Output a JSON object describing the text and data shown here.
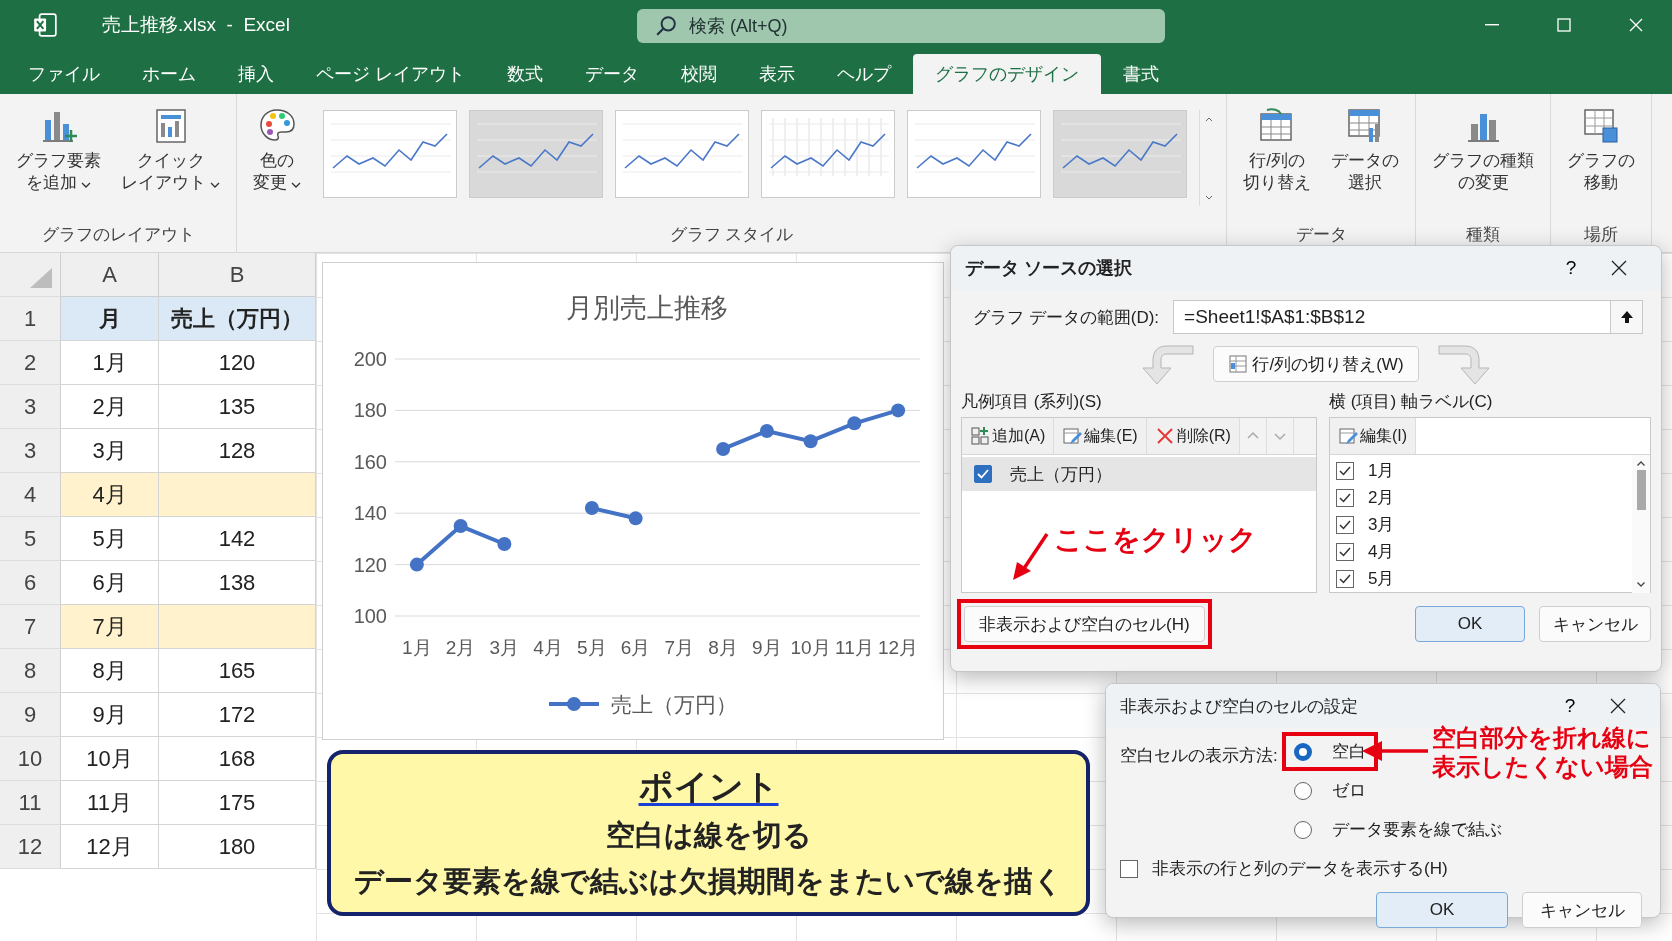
{
  "window": {
    "title": "売上推移.xlsx  -  Excel",
    "search_placeholder": "検索 (Alt+Q)"
  },
  "tabs": [
    {
      "label": "ファイル",
      "selected": false
    },
    {
      "label": "ホーム",
      "selected": false
    },
    {
      "label": "挿入",
      "selected": false
    },
    {
      "label": "ページ レイアウト",
      "selected": false
    },
    {
      "label": "数式",
      "selected": false
    },
    {
      "label": "データ",
      "selected": false
    },
    {
      "label": "校閲",
      "selected": false
    },
    {
      "label": "表示",
      "selected": false
    },
    {
      "label": "ヘルプ",
      "selected": false
    },
    {
      "label": "グラフのデザイン",
      "selected": true
    },
    {
      "label": "書式",
      "selected": false
    }
  ],
  "ribbon": [
    {
      "label": "グラフのレイアウト",
      "buttons": [
        {
          "lines": [
            "グラフ要素",
            "を追加"
          ],
          "dropdown": true
        },
        {
          "lines": [
            "クイック",
            "レイアウト"
          ],
          "dropdown": true
        }
      ]
    },
    {
      "label": "グラフ スタイル",
      "buttons": [
        {
          "lines": [
            "色の",
            "変更"
          ],
          "dropdown": true
        }
      ],
      "gallery": [
        {
          "kind": "plain"
        },
        {
          "kind": "shaded"
        },
        {
          "kind": "plain"
        },
        {
          "kind": "grid"
        },
        {
          "kind": "plain"
        },
        {
          "kind": "shaded"
        }
      ]
    },
    {
      "label": "データ",
      "buttons": [
        {
          "lines": [
            "行/列の",
            "切り替え"
          ],
          "dropdown": false
        },
        {
          "lines": [
            "データの",
            "選択"
          ],
          "dropdown": false
        }
      ]
    },
    {
      "label": "種類",
      "buttons": [
        {
          "lines": [
            "グラフの種類",
            "の変更"
          ],
          "dropdown": false
        }
      ]
    },
    {
      "label": "場所",
      "buttons": [
        {
          "lines": [
            "グラフの",
            "移動"
          ],
          "dropdown": false
        }
      ]
    }
  ],
  "sheet": {
    "columns": [
      "A",
      "B"
    ],
    "rows": [
      {
        "number": "1",
        "kind": "header",
        "cells": [
          "月",
          "売上（万円）"
        ]
      },
      {
        "number": "2",
        "kind": "normal",
        "cells": [
          "1月",
          "120"
        ]
      },
      {
        "number": "3",
        "kind": "normal",
        "cells": [
          "2月",
          "135"
        ]
      },
      {
        "number": "3",
        "kind": "normal",
        "cells": [
          "3月",
          "128"
        ]
      },
      {
        "number": "4",
        "kind": "missing",
        "cells": [
          "4月"
        ]
      },
      {
        "number": "5",
        "kind": "normal",
        "cells": [
          "5月",
          "142"
        ]
      },
      {
        "number": "6",
        "kind": "normal",
        "cells": [
          "6月",
          "138"
        ]
      },
      {
        "number": "7",
        "kind": "missing",
        "cells": [
          "7月"
        ]
      },
      {
        "number": "8",
        "kind": "normal",
        "cells": [
          "8月",
          "165"
        ]
      },
      {
        "number": "9",
        "kind": "normal",
        "cells": [
          "9月",
          "172"
        ]
      },
      {
        "number": "10",
        "kind": "normal",
        "cells": [
          "10月",
          "168"
        ]
      },
      {
        "number": "11",
        "kind": "normal",
        "cells": [
          "11月",
          "175"
        ]
      },
      {
        "number": "12",
        "kind": "normal",
        "cells": [
          "12月",
          "180"
        ]
      }
    ]
  },
  "chart": {
    "chart_data": {
      "type": "line",
      "title": "月別売上推移",
      "categories": [
        "1月",
        "2月",
        "3月",
        "4月",
        "5月",
        "6月",
        "7月",
        "8月",
        "9月",
        "10月",
        "11月",
        "12月"
      ],
      "series": [
        {
          "name": "売上（万円）",
          "color": "#4472c4",
          "marker": true,
          "values": [
            120,
            135,
            128,
            null,
            142,
            138,
            null,
            165,
            172,
            168,
            175,
            180
          ]
        }
      ],
      "grid": true,
      "ylim": [
        100,
        200
      ],
      "yticks": [
        100,
        120,
        140,
        160,
        180,
        200
      ]
    }
  },
  "callout": {
    "title": "ポイント",
    "lines": [
      "空白は線を切る",
      "データ要素を線で結ぶは欠損期間をまたいで線を描く"
    ]
  },
  "source_dialog": {
    "title": "データ ソースの選択",
    "help": "?",
    "range_label": "グラフ データの範囲(D):",
    "range_value": "=Sheet1!$A$1:$B$12",
    "switch_button": "行/列の切り替え(W)",
    "series_label": "凡例項目 (系列)(S)",
    "series_buttons": [
      "追加(A)",
      "編集(E)",
      "削除(R)"
    ],
    "series": [
      {
        "label": "売上（万円）",
        "checked": true,
        "selected": true
      }
    ],
    "axis_label": "横 (項目) 軸ラベル(C)",
    "axis_button": "編集(I)",
    "axis_items": [
      {
        "label": "1月",
        "checked": true
      },
      {
        "label": "2月",
        "checked": true
      },
      {
        "label": "3月",
        "checked": true
      },
      {
        "label": "4月",
        "checked": true
      },
      {
        "label": "5月",
        "checked": true
      }
    ],
    "hidden_button": "非表示および空白のセル(H)",
    "ok": "OK",
    "cancel": "キャンセル",
    "annotation": "ここをクリック"
  },
  "cells_dialog": {
    "title": "非表示および空白のセルの設定",
    "help": "?",
    "empty_label": "空白セルの表示方法:",
    "options": [
      {
        "label": "空白",
        "selected": true
      },
      {
        "label": "ゼロ",
        "selected": false
      },
      {
        "label": "データ要素を線で結ぶ",
        "selected": false
      }
    ],
    "hidden_checkbox": {
      "label": "非表示の行と列のデータを表示する(H)",
      "checked": false
    },
    "ok": "OK",
    "cancel": "キャンセル",
    "annotation_lines": [
      "空白部分を折れ線に",
      "表示したくない場合"
    ]
  }
}
